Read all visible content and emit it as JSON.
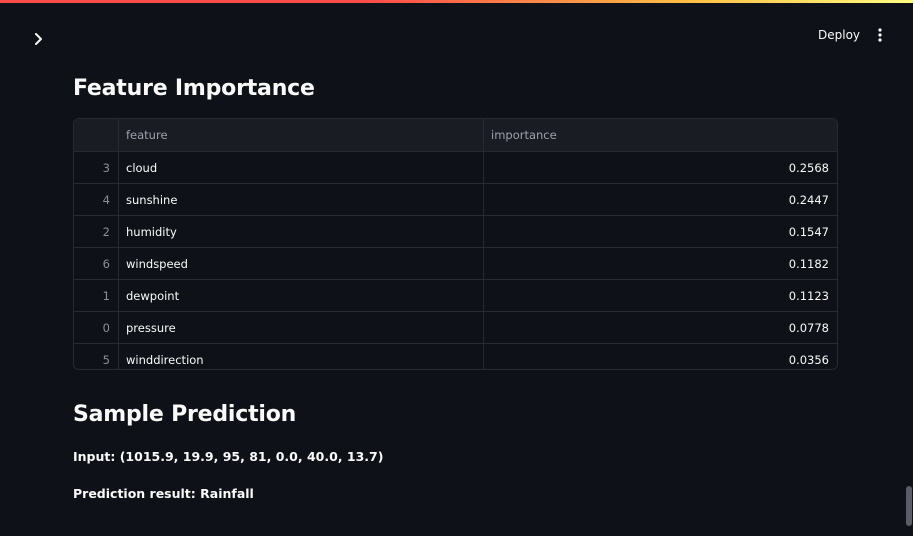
{
  "header": {
    "deploy_label": "Deploy"
  },
  "feature_importance": {
    "title": "Feature Importance",
    "columns": [
      "",
      "feature",
      "importance"
    ],
    "rows": [
      {
        "index": "3",
        "feature": "cloud",
        "importance": "0.2568"
      },
      {
        "index": "4",
        "feature": "sunshine",
        "importance": "0.2447"
      },
      {
        "index": "2",
        "feature": "humidity",
        "importance": "0.1547"
      },
      {
        "index": "6",
        "feature": "windspeed",
        "importance": "0.1182"
      },
      {
        "index": "1",
        "feature": "dewpoint",
        "importance": "0.1123"
      },
      {
        "index": "0",
        "feature": "pressure",
        "importance": "0.0778"
      },
      {
        "index": "5",
        "feature": "winddirection",
        "importance": "0.0356"
      }
    ]
  },
  "sample_prediction": {
    "title": "Sample Prediction",
    "input_text": "Input: (1015.9, 19.9, 95, 81, 0.0, 40.0, 13.7)",
    "result_text": "Prediction result: Rainfall"
  },
  "icons": {
    "sidebar_toggle": "chevron-right-icon",
    "menu": "more-vertical-icon"
  },
  "colors": {
    "background": "#0e1117",
    "table_header": "#1a1c24",
    "border": "#262a33",
    "accent_red": "#ff4b4b",
    "accent_yellow": "#fffd80"
  }
}
